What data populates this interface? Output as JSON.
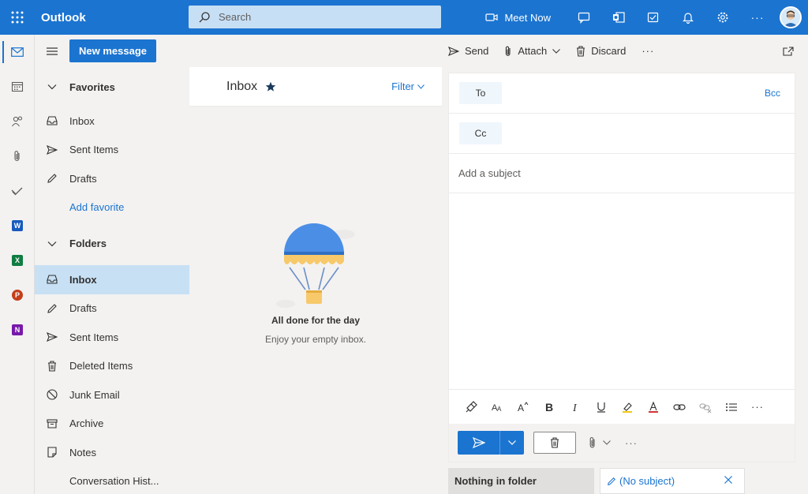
{
  "app": {
    "name": "Outlook"
  },
  "search": {
    "placeholder": "Search"
  },
  "topbar": {
    "meet_now": "Meet Now",
    "more": "···"
  },
  "rail": {
    "items": [
      {
        "name": "mail-icon"
      },
      {
        "name": "calendar-icon"
      },
      {
        "name": "people-icon"
      },
      {
        "name": "attachment-icon"
      },
      {
        "name": "todo-icon"
      },
      {
        "name": "word-icon",
        "letter": "W",
        "color": "#185abd"
      },
      {
        "name": "excel-icon",
        "letter": "X",
        "color": "#107c41"
      },
      {
        "name": "powerpoint-icon",
        "letter": "P",
        "color": "#c43e1c"
      },
      {
        "name": "onenote-icon",
        "letter": "N",
        "color": "#7719aa"
      }
    ]
  },
  "folder_pane": {
    "new_message": "New message",
    "favorites_heading": "Favorites",
    "favorites": [
      "Inbox",
      "Sent Items",
      "Drafts"
    ],
    "add_favorite": "Add favorite",
    "folders_heading": "Folders",
    "folders": [
      "Inbox",
      "Drafts",
      "Sent Items",
      "Deleted Items",
      "Junk Email",
      "Archive",
      "Notes",
      "Conversation Hist..."
    ],
    "selected_folder": "Inbox"
  },
  "message_list": {
    "title": "Inbox",
    "filter": "Filter",
    "empty_title": "All done for the day",
    "empty_subtitle": "Enjoy your empty inbox."
  },
  "command_bar": {
    "send": "Send",
    "attach": "Attach",
    "discard": "Discard",
    "more": "···"
  },
  "compose": {
    "to_label": "To",
    "cc_label": "Cc",
    "bcc_label": "Bcc",
    "subject_placeholder": "Add a subject",
    "more": "···"
  },
  "bottom_tabs": {
    "status": "Nothing in folder",
    "draft": "(No subject)"
  },
  "colors": {
    "brand": "#1b74d0",
    "selected": "#c7e0f4"
  }
}
